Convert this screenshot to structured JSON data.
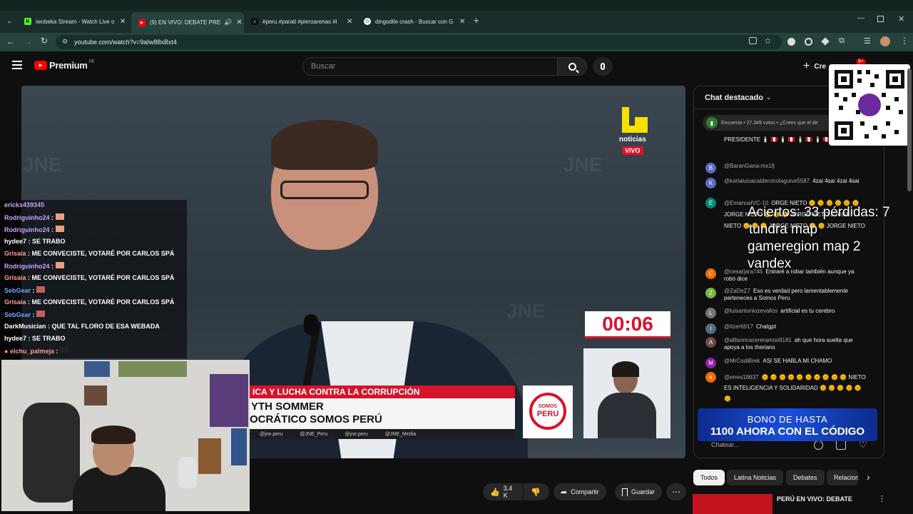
{
  "browser": {
    "tabs": [
      {
        "title": "iwobeka Stream - Watch Live o",
        "favicon_color": "#53fc18",
        "favicon_text": "K"
      },
      {
        "title": "(9) EN VIVO: DEBATE PRESI",
        "favicon_color": "#ff0000",
        "favicon_text": "▶"
      },
      {
        "title": "#peru #parati #pieroarenas #l",
        "favicon_color": "#111111",
        "favicon_text": "♪"
      },
      {
        "title": "dingodile crash - Buscar con G",
        "favicon_color": "#ffffff",
        "favicon_text": "G"
      }
    ],
    "url": "youtube.com/watch?v=9aIw88xBxt4"
  },
  "youtube": {
    "logo_text": "Premium",
    "region": "PE",
    "search_placeholder": "Buscar",
    "create_label": "Cre",
    "notif_count": "9+"
  },
  "video": {
    "watermark": "JNE",
    "channel_name": "noticias",
    "live_label": "VIVO",
    "timer": "00:06",
    "lower_third_topic": "ICA Y LUCHA CONTRA LA CORRUPCIÓN",
    "lower_third_name": "YTH SOMMER",
    "lower_third_party": "OCRÁTICO SOMOS PERÚ",
    "social": [
      "@jne.peru",
      "@JNE_Peru",
      "@jne.peru",
      "@JNE_Media"
    ],
    "party_logo_top": "SOMOS",
    "party_logo_bottom": "PERU"
  },
  "stream_chat": [
    {
      "name": "ericks439345",
      "text": ""
    },
    {
      "name": "Rodriguinho24",
      "text": ""
    },
    {
      "name": "Rodriguinho24",
      "text": ""
    },
    {
      "name": "hydee7",
      "text": "SE TRABO"
    },
    {
      "name": "Grisaia",
      "text": "ME CONVECISTE, VOTARÉ POR CARLOS SPÁ"
    },
    {
      "name": "Rodriguinho24",
      "text": ""
    },
    {
      "name": "Grisaia",
      "text": "ME CONVECISTE, VOTARÉ POR CARLOS SPÁ"
    },
    {
      "name": "SebGear",
      "text": ""
    },
    {
      "name": "Grisaia",
      "text": "ME CONVECISTE, VOTARÉ POR CARLOS SPÁ"
    },
    {
      "name": "SebGear",
      "text": ""
    },
    {
      "name": "DarkMusician",
      "text": "QUE TAL FLORO DE ESA WEBADA"
    },
    {
      "name": "hydee7",
      "text": "SE TRABO"
    },
    {
      "name": "elchu_palmeja",
      "text": ""
    }
  ],
  "live_chat": {
    "header": "Chat destacado",
    "poll_text": "Encuesta • 27.349 votos • ¿Crees que el de",
    "messages": [
      {
        "initial": "",
        "color": "#0f0f0f",
        "author": "",
        "text": "PRESIDENTE 🕯️ 🇵🇪 🕯️ 🇵🇪 🕯️ 🇵🇪 🕯️ 🇵🇪"
      },
      {
        "initial": "B",
        "color": "#5c6bc0",
        "author": "@BaranGana-mx1fj",
        "text": ""
      },
      {
        "initial": "K",
        "color": "#5c6bc0",
        "author": "@karlaluisacalderonolaguive5587",
        "text": "4zai 4sai 4zai 4sai"
      },
      {
        "initial": "E",
        "color": "#00897b",
        "author": "@EmanuelVC-10",
        "text": "ORGE NIETO 🌞 🌞 🌞 🌞 🌞 🌞 JORGE NIETO 🌞 🌞 🌞 JORGE NIETO JORGE NIETO 🌞 🌞 🌞 JORGE NIETO 🌞 🌞 JORGE NIETO"
      },
      {
        "initial": "C",
        "color": "#ef6c00",
        "author": "@cesarjara745",
        "text": "Entraré a robar también aunque ya robó dice"
      },
      {
        "initial": "Z",
        "color": "#7cb342",
        "author": "@ZaDeZ7",
        "text": "Eso es verdad pero lamentablemente perteneces a Somos Peru"
      },
      {
        "initial": "L",
        "color": "#757575",
        "author": "@luisantoniozevallos",
        "text": "artificial es tu cerebro"
      },
      {
        "initial": "I",
        "color": "#546e7a",
        "author": "@itzer6917",
        "text": "Chatgpt"
      },
      {
        "initial": "A",
        "color": "#6d4c41",
        "author": "@allisoncacereramos9181",
        "text": "ah que hora suelta que apoya a los therians"
      },
      {
        "initial": "M",
        "color": "#8e24aa",
        "author": "@MrCodiBrek",
        "text": "ASI SE HABLA MI CHAMO"
      },
      {
        "initial": "e",
        "color": "#ef6c00",
        "author": "@erres18637",
        "text": "🌞 🌞 🌞 🌞 🌞 🌞 🌞 🌞 🌞 🌞 NIETO ES INTELIGENCIA Y SOLIDARIDAD 🌞 🌞 🌞 🌞 🌞 🌞"
      }
    ],
    "input_placeholder": "Chatear..."
  },
  "overlay": {
    "lines": [
      "Aciertos: 33 pérdidas: 7",
      "tundra map",
      "gameregion map 2",
      "vandex"
    ]
  },
  "promo": {
    "line1": "BONO DE HASTA",
    "line2": "1100 AHORA CON EL CÓDIGO"
  },
  "actions": {
    "likes": "3,4 K",
    "share": "Compartir",
    "save": "Guardar"
  },
  "chips": [
    "Todos",
    "Latina Noticias",
    "Debates",
    "Relacion"
  ],
  "recommended": {
    "title": "PERÚ EN VIVO: DEBATE"
  }
}
